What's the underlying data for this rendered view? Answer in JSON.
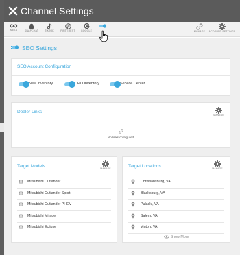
{
  "header": {
    "title": "Channel Settings"
  },
  "toolbar": {
    "tabs": [
      {
        "id": "meta",
        "label": "META",
        "icon": "meta-infinity-icon"
      },
      {
        "id": "snapchat",
        "label": "SNAPCHAT",
        "icon": "snapchat-ghost-icon"
      },
      {
        "id": "tiktok",
        "label": "TIKTOK",
        "icon": "tiktok-note-icon"
      },
      {
        "id": "pinterest",
        "label": "PINTEREST",
        "icon": "pinterest-icon"
      },
      {
        "id": "google",
        "label": "GOOGLE",
        "icon": "google-g-icon"
      },
      {
        "id": "seo",
        "label": "",
        "icon": "seo-toggle-icon",
        "active": true
      }
    ],
    "right": [
      {
        "label": "MANAGE",
        "icon": "link-icon"
      },
      {
        "label": "ACCOUNT SETTINGS",
        "icon": "gear-icon"
      }
    ]
  },
  "seo": {
    "title": "SEO Settings"
  },
  "account_config": {
    "title": "SEO Account Configuration",
    "toggles": [
      {
        "label": "New Inventory",
        "on": true
      },
      {
        "label": "CPO Inventory",
        "on": true
      },
      {
        "label": "Service Center",
        "on": true
      }
    ]
  },
  "dealer_links": {
    "title": "Dealer Links",
    "manage_label": "MANAGE",
    "empty_text": "No links configured"
  },
  "target_models": {
    "title": "Target Models",
    "manage_label": "MANAGE",
    "items": [
      "Mitsubishi Outlander",
      "Mitsubishi Outlander Sport",
      "Mitsubishi Outlander PHEV",
      "Mitsubishi Mirage",
      "Mitsubishi Eclipse"
    ]
  },
  "target_locations": {
    "title": "Target Locations",
    "manage_label": "MANAGE",
    "items": [
      "Christiansburg, VA",
      "Blacksburg, VA",
      "Pulaski, VA",
      "Salem, VA",
      "Vinton, VA"
    ],
    "show_more": "Show More"
  },
  "colors": {
    "accent": "#3aa7dc",
    "header_bg": "#5b5b5b",
    "content_bg": "#efefef"
  }
}
